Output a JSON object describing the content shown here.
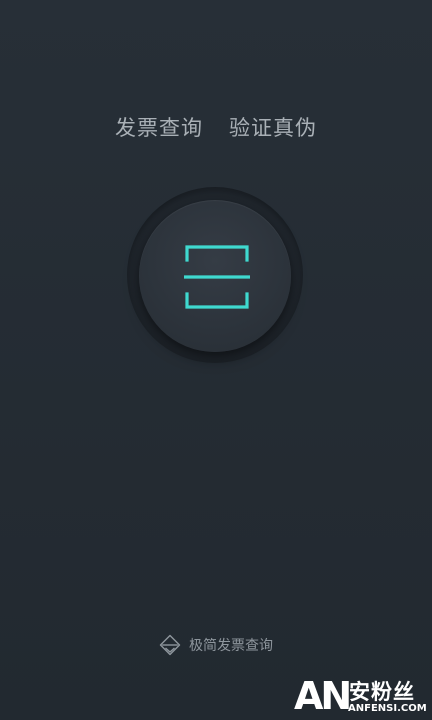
{
  "header": {
    "title_left": "发票查询",
    "title_right": "验证真伪"
  },
  "scan_button": {
    "icon": "scan-frame-icon",
    "accent_color": "#3fd9cf"
  },
  "footer_link": {
    "icon": "diamond-layers-icon",
    "label": "极简发票查询"
  },
  "watermark": {
    "logo": "AN",
    "chinese": "安粉丝",
    "domain": "ANFENSI.COM"
  }
}
